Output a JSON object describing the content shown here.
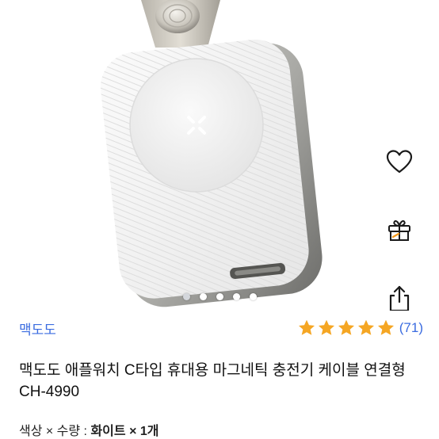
{
  "colors": {
    "accent": "#3b6ce0",
    "star": "#f5a623",
    "text": "#111111"
  },
  "hero": {
    "image": "apple-watch-magnetic-charger-product-photo",
    "page_count": 5,
    "active_index": 0,
    "actions": [
      {
        "icon": "heart-icon"
      },
      {
        "icon": "gift-icon"
      },
      {
        "icon": "share-icon"
      }
    ]
  },
  "seller": {
    "name": "맥도도"
  },
  "rating": {
    "stars": 5,
    "count_label": "(71)"
  },
  "product": {
    "title": "맥도도 애플워치 C타입 휴대용 마그네틱 충전기 케이블 연결형 CH-4990"
  },
  "option": {
    "label": "색상 × 수량 : ",
    "color": "화이트",
    "separator": " × ",
    "quantity": "1개"
  }
}
